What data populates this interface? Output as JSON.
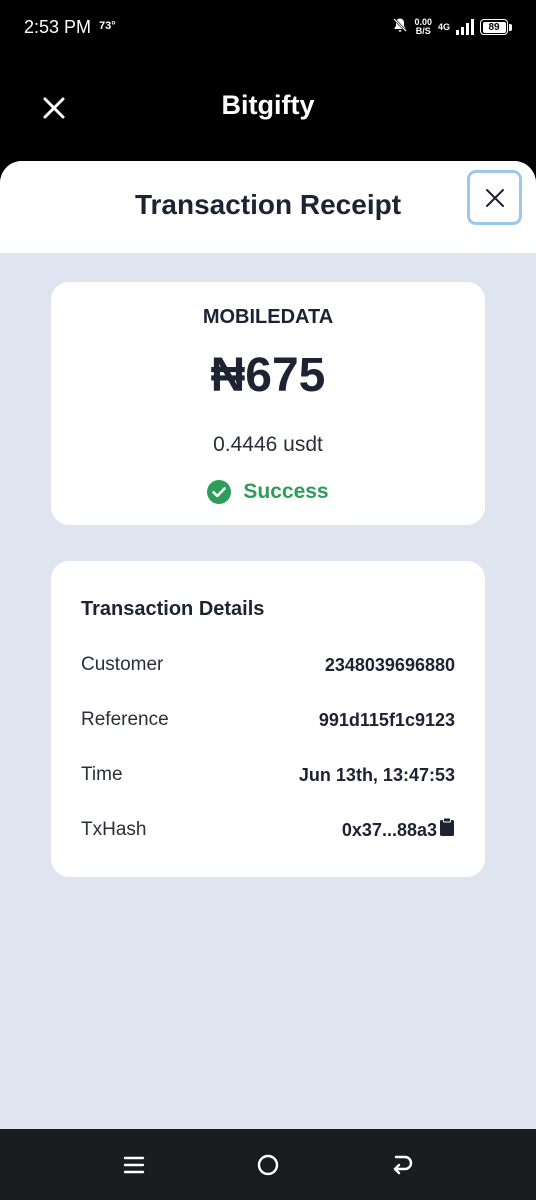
{
  "status_bar": {
    "time": "2:53 PM",
    "temperature": "73°",
    "net_speed_value": "0.00",
    "net_speed_unit": "B/S",
    "network": "4G",
    "battery": "89"
  },
  "header": {
    "title": "Bitgifty",
    "close_icon": "close-icon"
  },
  "sheet": {
    "title": "Transaction Receipt",
    "close_icon": "close-icon"
  },
  "summary": {
    "service": "MOBILEDATA",
    "amount": "₦675",
    "crypto_amount": "0.4446 usdt",
    "status": "Success",
    "status_icon": "check-circle-icon",
    "status_color": "#2e9d5a"
  },
  "details": {
    "title": "Transaction Details",
    "rows": [
      {
        "label": "Customer",
        "value": "2348039696880"
      },
      {
        "label": "Reference",
        "value": "991d115f1c9123"
      },
      {
        "label": "Time",
        "value": "Jun 13th, 13:47:53"
      },
      {
        "label": "TxHash",
        "value": "0x37...88a3",
        "icon": "clipboard-icon"
      }
    ]
  },
  "nav": {
    "icons": [
      "menu-icon",
      "home-icon",
      "back-icon"
    ]
  },
  "colors": {
    "sheet_background": "#dfe5f0",
    "accent_outline": "#9ec6e8",
    "text_dark": "#1c2333"
  }
}
